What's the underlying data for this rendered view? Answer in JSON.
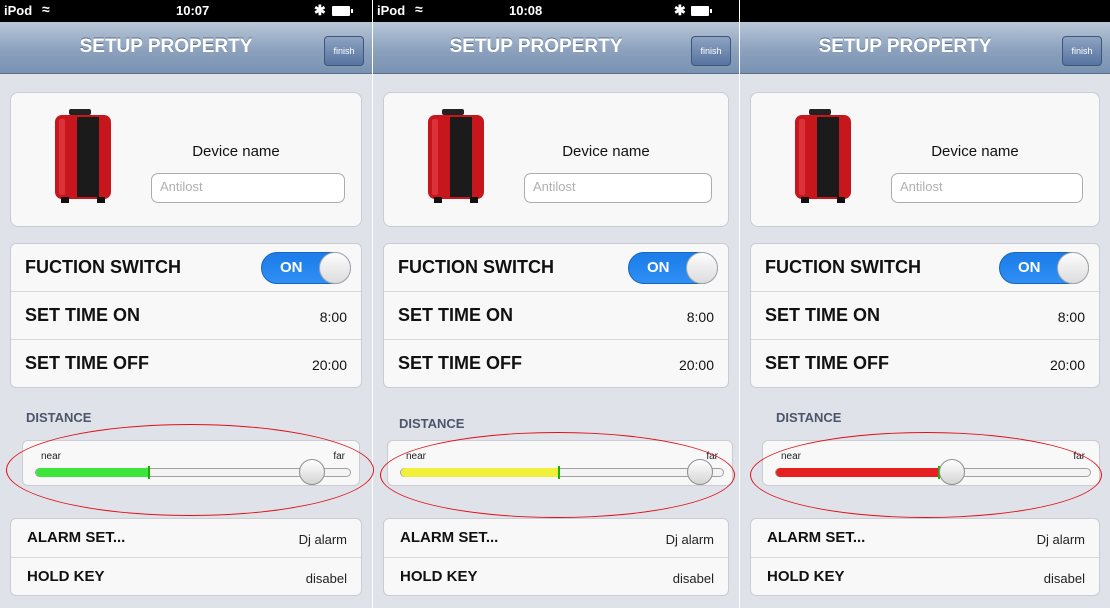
{
  "screens": [
    {
      "status": {
        "carrier": "iPod",
        "time": "10:07"
      },
      "nav": {
        "title": "SETUP PROPERTY",
        "finish_label": "finish"
      },
      "device": {
        "label": "Device name",
        "name_placeholder": "Antilost"
      },
      "settings": {
        "function_switch": {
          "label": "FUCTION SWITCH",
          "state": "ON"
        },
        "time_on": {
          "label": "SET TIME ON",
          "value": "8:00"
        },
        "time_off": {
          "label": "SET TIME OFF",
          "value": "20:00"
        }
      },
      "distance": {
        "label": "DISTANCE",
        "near_label": "near",
        "far_label": "far",
        "level": 0.88,
        "fill_fraction": 0.36,
        "fill_color": "#3be53b"
      },
      "alarm": {
        "label": "ALARM SET...",
        "value": "Dj alarm"
      },
      "hold_key": {
        "label": "HOLD KEY",
        "value": "disabel"
      }
    },
    {
      "status": {
        "carrier": "iPod",
        "time": "10:08"
      },
      "nav": {
        "title": "SETUP PROPERTY",
        "finish_label": "finish"
      },
      "device": {
        "label": "Device name",
        "name_placeholder": "Antilost"
      },
      "settings": {
        "function_switch": {
          "label": "FUCTION SWITCH",
          "state": "ON"
        },
        "time_on": {
          "label": "SET TIME ON",
          "value": "8:00"
        },
        "time_off": {
          "label": "SET TIME OFF",
          "value": "20:00"
        }
      },
      "distance": {
        "label": "DISTANCE",
        "near_label": "near",
        "far_label": "far",
        "level": 0.93,
        "fill_fraction": 0.49,
        "fill_color": "#f0f03a"
      },
      "alarm": {
        "label": "ALARM SET...",
        "value": "Dj alarm"
      },
      "hold_key": {
        "label": "HOLD KEY",
        "value": "disabel"
      }
    },
    {
      "status": {
        "carrier": "",
        "time": ""
      },
      "nav": {
        "title": "SETUP PROPERTY",
        "finish_label": "finish"
      },
      "device": {
        "label": "Device name",
        "name_placeholder": "Antilost"
      },
      "settings": {
        "function_switch": {
          "label": "FUCTION SWITCH",
          "state": "ON"
        },
        "time_on": {
          "label": "SET TIME ON",
          "value": "8:00"
        },
        "time_off": {
          "label": "SET TIME OFF",
          "value": "20:00"
        }
      },
      "distance": {
        "label": "DISTANCE",
        "near_label": "near",
        "far_label": "far",
        "level": 0.56,
        "fill_fraction": 0.52,
        "fill_color": "#e62020"
      },
      "alarm": {
        "label": "ALARM SET...",
        "value": "Dj alarm"
      },
      "hold_key": {
        "label": "HOLD KEY",
        "value": "disabel"
      }
    }
  ],
  "colors": {
    "highlight": "#e0101a",
    "toggle_on": "#2585f0",
    "nav_bar": "#8ba1bd"
  },
  "icons": [
    "wifi-icon",
    "bluetooth-icon",
    "battery-icon",
    "suitcase-icon"
  ]
}
